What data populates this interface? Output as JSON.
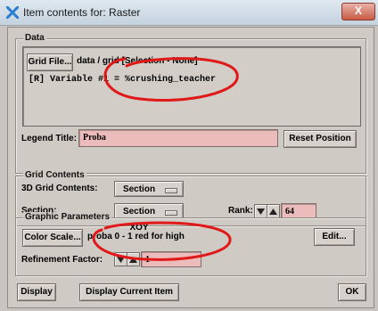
{
  "window": {
    "title": "Item contents for: Raster",
    "close_symbol": "X"
  },
  "data_group": {
    "title": "Data",
    "grid_file_button": "Grid File...",
    "grid_path": "data / grid [Selection - None]",
    "variable_line": "[R] Variable #1 = %crushing_teacher"
  },
  "legend": {
    "label": "Legend Title:",
    "value": "Proba",
    "reset_button": "Reset Position"
  },
  "grid_contents": {
    "title": "Grid Contents",
    "contents_label": "3D Grid Contents:",
    "contents_value": "Section",
    "section_label": "Section:",
    "section_value": "Section XOY",
    "rank_label": "Rank:",
    "rank_value": "64"
  },
  "graphic": {
    "title": "Graphic Parameters",
    "color_scale_button": "Color Scale...",
    "color_scale_value": "proba 0 - 1 red for high",
    "edit_button": "Edit...",
    "refinement_label": "Refinement Factor:",
    "refinement_value": "1"
  },
  "footer": {
    "display_button": "Display",
    "display_current_button": "Display Current Item",
    "ok_button": "OK"
  },
  "colors": {
    "annotation_red": "#e01818",
    "field_pink": "#ecbcbc"
  }
}
